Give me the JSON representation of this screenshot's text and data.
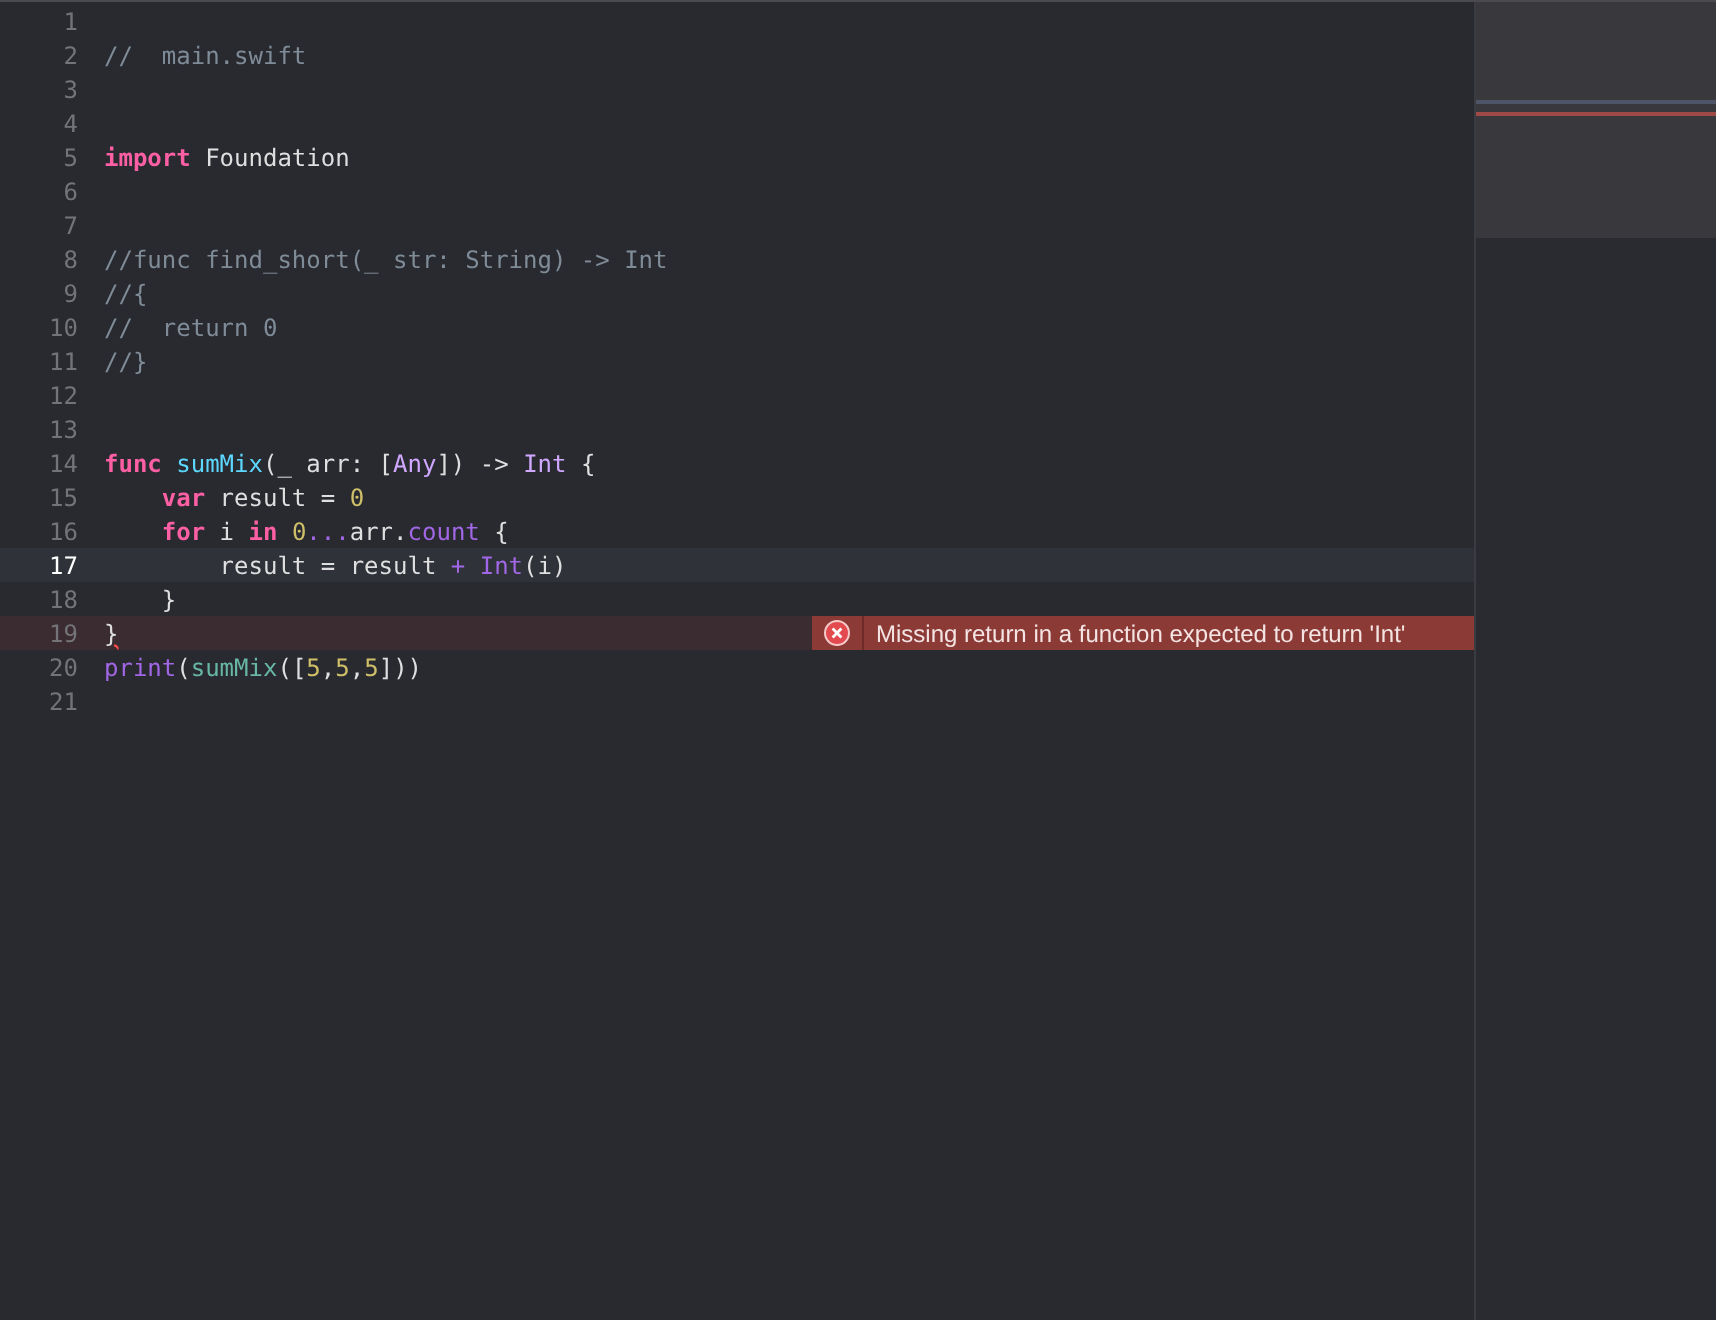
{
  "editor": {
    "lines": [
      {
        "number": "1",
        "current": false
      },
      {
        "number": "2",
        "current": false,
        "tokens": [
          {
            "kind": "comment",
            "text": "//  main.swift"
          }
        ]
      },
      {
        "number": "3",
        "current": false
      },
      {
        "number": "4",
        "current": false
      },
      {
        "number": "5",
        "current": false,
        "tokens": [
          {
            "kind": "keyword",
            "text": "import"
          },
          {
            "kind": "plain",
            "text": " Foundation"
          }
        ]
      },
      {
        "number": "6",
        "current": false
      },
      {
        "number": "7",
        "current": false
      },
      {
        "number": "8",
        "current": false,
        "tokens": [
          {
            "kind": "comment",
            "text": "//func find_short(_ str: String) -> Int"
          }
        ]
      },
      {
        "number": "9",
        "current": false,
        "tokens": [
          {
            "kind": "comment",
            "text": "//{"
          }
        ]
      },
      {
        "number": "10",
        "current": false,
        "tokens": [
          {
            "kind": "comment",
            "text": "//  return 0"
          }
        ]
      },
      {
        "number": "11",
        "current": false,
        "tokens": [
          {
            "kind": "comment",
            "text": "//}"
          }
        ]
      },
      {
        "number": "12",
        "current": false
      },
      {
        "number": "13",
        "current": false
      },
      {
        "number": "14",
        "current": false,
        "tokens": [
          {
            "kind": "keyword",
            "text": "func"
          },
          {
            "kind": "declaration",
            "text": " sumMix"
          },
          {
            "kind": "plain",
            "text": "(_ arr: ["
          },
          {
            "kind": "type",
            "text": "Any"
          },
          {
            "kind": "plain",
            "text": "]) -> "
          },
          {
            "kind": "type",
            "text": "Int"
          },
          {
            "kind": "plain",
            "text": " {"
          }
        ]
      },
      {
        "number": "15",
        "current": false,
        "tokens": [
          {
            "kind": "keyword",
            "text": "    var"
          },
          {
            "kind": "plain",
            "text": " result = "
          },
          {
            "kind": "number",
            "text": "0"
          }
        ]
      },
      {
        "number": "16",
        "current": false,
        "tokens": [
          {
            "kind": "keyword",
            "text": "    for"
          },
          {
            "kind": "plain",
            "text": " i "
          },
          {
            "kind": "keyword",
            "text": "in"
          },
          {
            "kind": "number",
            "text": " 0"
          },
          {
            "kind": "member",
            "text": "..."
          },
          {
            "kind": "plain",
            "text": "arr."
          },
          {
            "kind": "member",
            "text": "count"
          },
          {
            "kind": "plain",
            "text": " {"
          }
        ]
      },
      {
        "number": "17",
        "current": true,
        "tokens": [
          {
            "kind": "plain",
            "text": "        result = result "
          },
          {
            "kind": "member",
            "text": "+"
          },
          {
            "kind": "member",
            "text": " Int"
          },
          {
            "kind": "plain",
            "text": "(i)"
          }
        ]
      },
      {
        "number": "18",
        "current": false,
        "tokens": [
          {
            "kind": "plain",
            "text": "    }"
          }
        ]
      },
      {
        "number": "19",
        "current": false,
        "tokens": [
          {
            "kind": "error",
            "text": "}"
          }
        ],
        "error": "Missing return in a function expected to return 'Int'"
      },
      {
        "number": "20",
        "current": false,
        "tokens": [
          {
            "kind": "member",
            "text": "print"
          },
          {
            "kind": "plain",
            "text": "("
          },
          {
            "kind": "call",
            "text": "sumMix"
          },
          {
            "kind": "plain",
            "text": "(["
          },
          {
            "kind": "number",
            "text": "5"
          },
          {
            "kind": "plain",
            "text": ","
          },
          {
            "kind": "number",
            "text": "5"
          },
          {
            "kind": "plain",
            "text": ","
          },
          {
            "kind": "number",
            "text": "5"
          },
          {
            "kind": "plain",
            "text": "]))"
          }
        ]
      },
      {
        "number": "21",
        "current": false
      }
    ]
  }
}
